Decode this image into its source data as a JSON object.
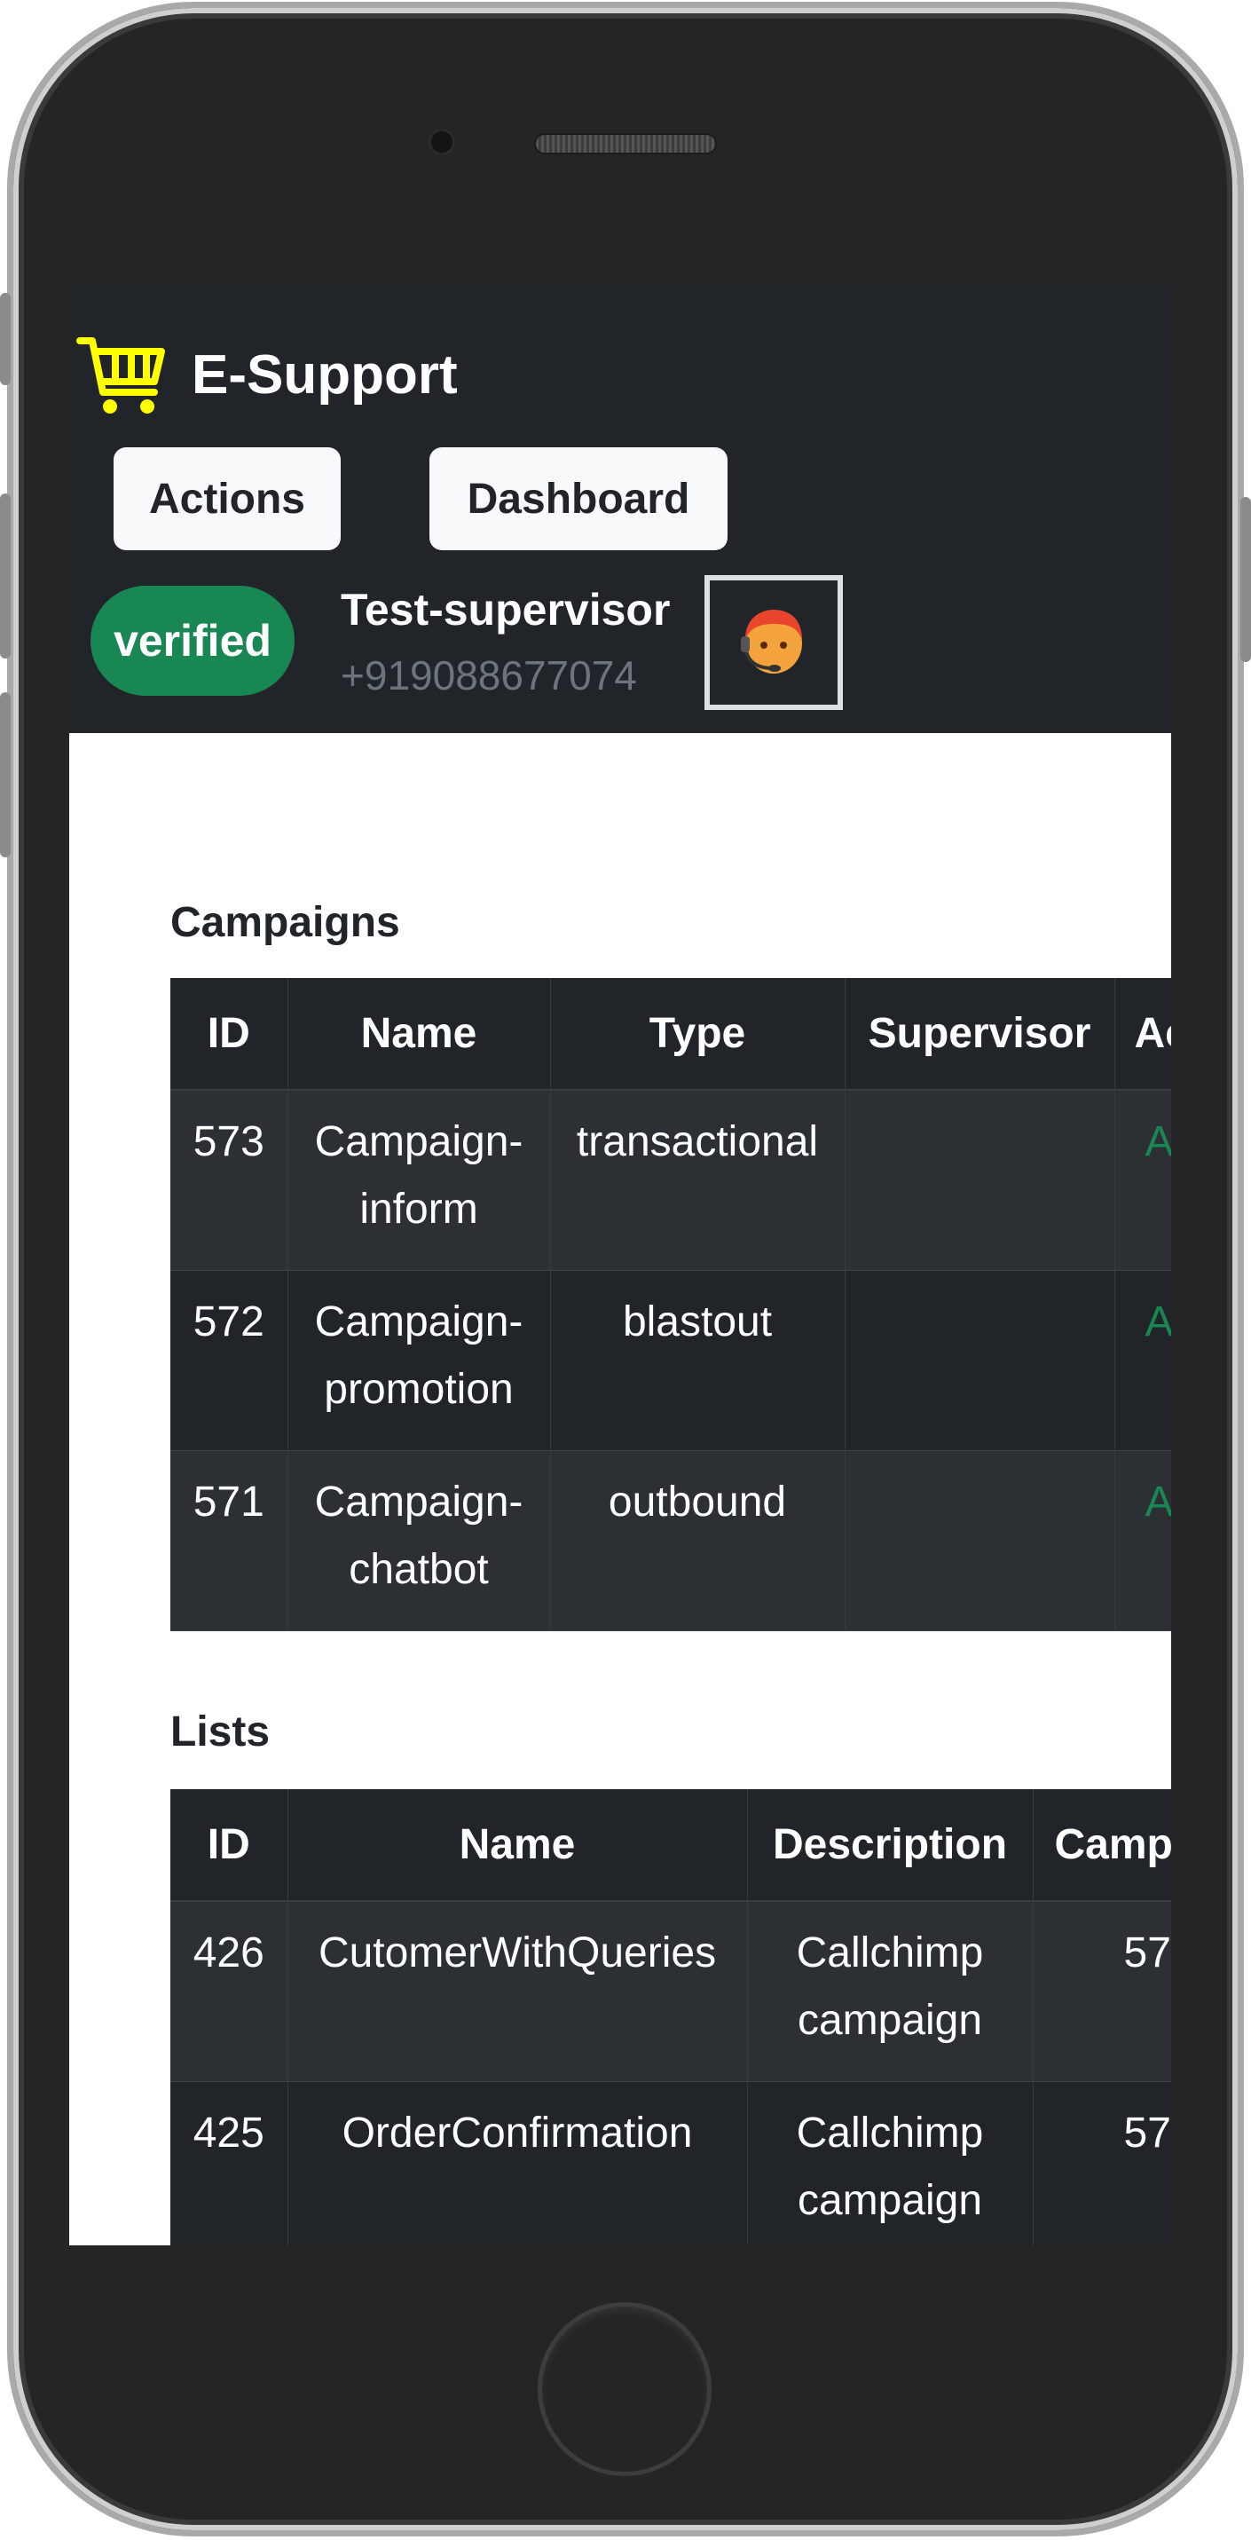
{
  "app": {
    "brand_name": "E-Support",
    "brand_icon": "shopping-cart-icon",
    "accent_color": "#ffff00"
  },
  "nav": {
    "actions_label": "Actions",
    "dashboard_label": "Dashboard"
  },
  "user": {
    "status": "verified",
    "status_color": "#198754",
    "name": "Test-supervisor",
    "phone": "+919088677074",
    "avatar_icon": "support-agent-icon"
  },
  "campaigns": {
    "title": "Campaigns",
    "columns": [
      "ID",
      "Name",
      "Type",
      "Supervisor",
      "Ac"
    ],
    "rows": [
      {
        "id": "573",
        "name": "Campaign-inform",
        "type": "transactional",
        "supervisor": "",
        "status": "A"
      },
      {
        "id": "572",
        "name": "Campaign-promotion",
        "type": "blastout",
        "supervisor": "",
        "status": "A"
      },
      {
        "id": "571",
        "name": "Campaign-chatbot",
        "type": "outbound",
        "supervisor": "",
        "status": "A"
      }
    ]
  },
  "lists": {
    "title": "Lists",
    "columns": [
      "ID",
      "Name",
      "Description",
      "Camp"
    ],
    "rows": [
      {
        "id": "426",
        "name": "CutomerWithQueries",
        "description": "Callchimp campaign",
        "campaign": "57"
      },
      {
        "id": "425",
        "name": "OrderConfirmation",
        "description": "Callchimp campaign",
        "campaign": "57"
      }
    ]
  }
}
